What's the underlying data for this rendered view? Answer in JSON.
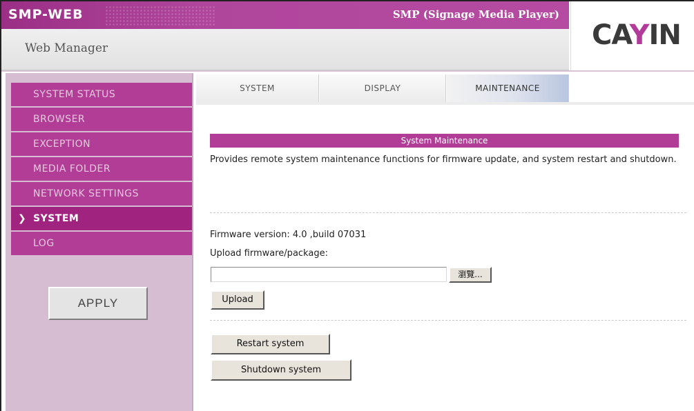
{
  "header": {
    "brand": "SMP-WEB",
    "product_title": "SMP (Signage Media Player)",
    "subtitle": "Web Manager",
    "logo_text_left": "CA",
    "logo_text_accent": "Y",
    "logo_text_right": "IN"
  },
  "colors": {
    "accent": "#b13d97",
    "sidebar_bg": "#d6bdd2"
  },
  "sidebar": {
    "items": [
      {
        "label": "SYSTEM STATUS",
        "active": false
      },
      {
        "label": "BROWSER",
        "active": false
      },
      {
        "label": "EXCEPTION",
        "active": false
      },
      {
        "label": "MEDIA FOLDER",
        "active": false
      },
      {
        "label": "NETWORK SETTINGS",
        "active": false
      },
      {
        "label": "SYSTEM",
        "active": true
      },
      {
        "label": "LOG",
        "active": false
      }
    ],
    "active_marker": "❯",
    "apply_label": "APPLY"
  },
  "tabs": [
    {
      "label": "SYSTEM",
      "active": false
    },
    {
      "label": "DISPLAY",
      "active": false
    },
    {
      "label": "MAINTENANCE",
      "active": true
    }
  ],
  "maintenance": {
    "section_title": "System Maintenance",
    "description": "Provides remote system maintenance functions for firmware update, and system restart and shutdown.",
    "firmware_version": "Firmware version: 4.0 ,build 07031",
    "upload_label": "Upload firmware/package:",
    "file_value": "",
    "browse_label": "瀏覽...",
    "upload_button": "Upload",
    "restart_button": "Restart system",
    "shutdown_button": "Shutdown system"
  }
}
